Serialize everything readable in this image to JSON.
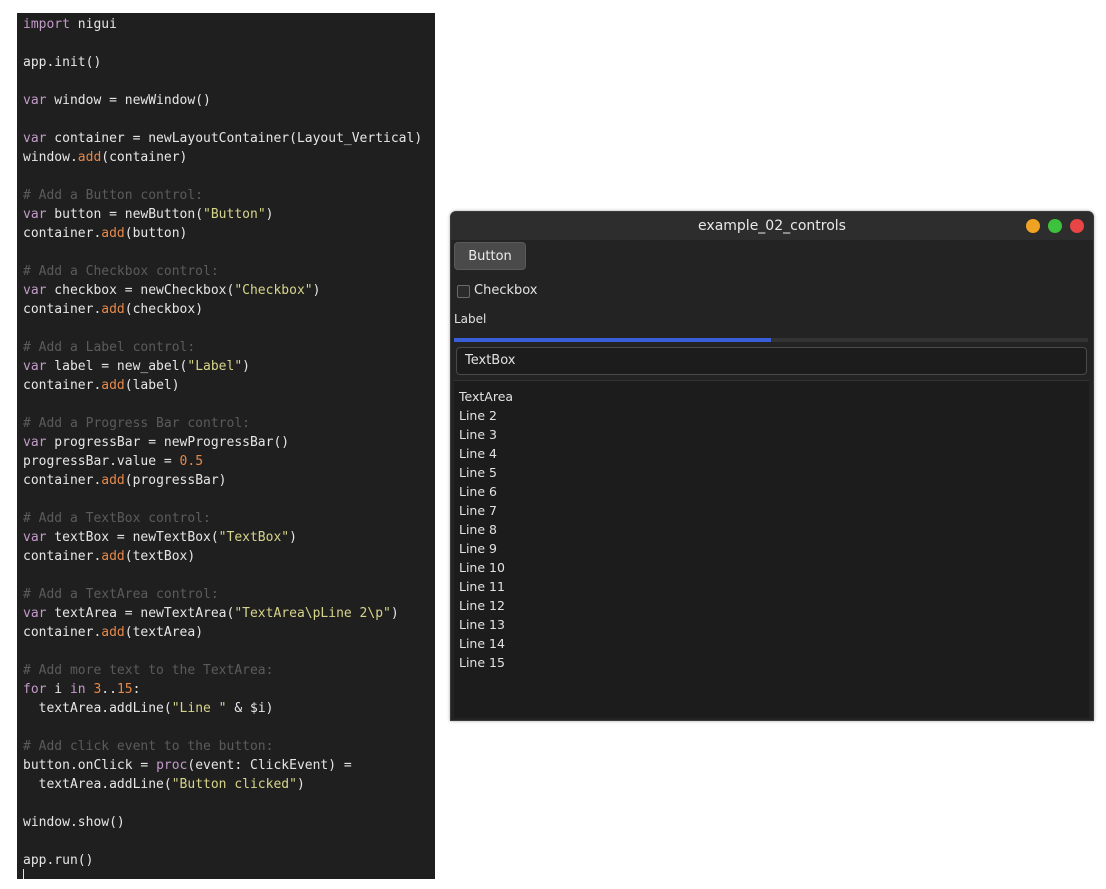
{
  "editor": {
    "lines": [
      [
        {
          "t": "import",
          "c": "kw"
        },
        {
          "t": " nigui",
          "c": "plain"
        }
      ],
      [],
      [
        {
          "t": "app.init()",
          "c": "plain"
        }
      ],
      [],
      [
        {
          "t": "var",
          "c": "kw"
        },
        {
          "t": " window = newWindow()",
          "c": "plain"
        }
      ],
      [],
      [
        {
          "t": "var",
          "c": "kw"
        },
        {
          "t": " container = newLayoutContainer(Layout_Vertical)",
          "c": "plain"
        }
      ],
      [
        {
          "t": "window.",
          "c": "plain"
        },
        {
          "t": "add",
          "c": "fn"
        },
        {
          "t": "(container)",
          "c": "plain"
        }
      ],
      [],
      [
        {
          "t": "# Add a Button control:",
          "c": "com"
        }
      ],
      [
        {
          "t": "var",
          "c": "kw"
        },
        {
          "t": " button = newButton(",
          "c": "plain"
        },
        {
          "t": "\"Button\"",
          "c": "str"
        },
        {
          "t": ")",
          "c": "plain"
        }
      ],
      [
        {
          "t": "container.",
          "c": "plain"
        },
        {
          "t": "add",
          "c": "fn"
        },
        {
          "t": "(button)",
          "c": "plain"
        }
      ],
      [],
      [
        {
          "t": "# Add a Checkbox control:",
          "c": "com"
        }
      ],
      [
        {
          "t": "var",
          "c": "kw"
        },
        {
          "t": " checkbox = newCheckbox(",
          "c": "plain"
        },
        {
          "t": "\"Checkbox\"",
          "c": "str"
        },
        {
          "t": ")",
          "c": "plain"
        }
      ],
      [
        {
          "t": "container.",
          "c": "plain"
        },
        {
          "t": "add",
          "c": "fn"
        },
        {
          "t": "(checkbox)",
          "c": "plain"
        }
      ],
      [],
      [
        {
          "t": "# Add a Label control:",
          "c": "com"
        }
      ],
      [
        {
          "t": "var",
          "c": "kw"
        },
        {
          "t": " label = new_abel(",
          "c": "plain"
        },
        {
          "t": "\"Label\"",
          "c": "str"
        },
        {
          "t": ")",
          "c": "plain"
        }
      ],
      [
        {
          "t": "container.",
          "c": "plain"
        },
        {
          "t": "add",
          "c": "fn"
        },
        {
          "t": "(label)",
          "c": "plain"
        }
      ],
      [],
      [
        {
          "t": "# Add a Progress Bar control:",
          "c": "com"
        }
      ],
      [
        {
          "t": "var",
          "c": "kw"
        },
        {
          "t": " progressBar = newProgressBar()",
          "c": "plain"
        }
      ],
      [
        {
          "t": "progressBar.value = ",
          "c": "plain"
        },
        {
          "t": "0.5",
          "c": "num"
        }
      ],
      [
        {
          "t": "container.",
          "c": "plain"
        },
        {
          "t": "add",
          "c": "fn"
        },
        {
          "t": "(progressBar)",
          "c": "plain"
        }
      ],
      [],
      [
        {
          "t": "# Add a TextBox control:",
          "c": "com"
        }
      ],
      [
        {
          "t": "var",
          "c": "kw"
        },
        {
          "t": " textBox = newTextBox(",
          "c": "plain"
        },
        {
          "t": "\"TextBox\"",
          "c": "str"
        },
        {
          "t": ")",
          "c": "plain"
        }
      ],
      [
        {
          "t": "container.",
          "c": "plain"
        },
        {
          "t": "add",
          "c": "fn"
        },
        {
          "t": "(textBox)",
          "c": "plain"
        }
      ],
      [],
      [
        {
          "t": "# Add a TextArea control:",
          "c": "com"
        }
      ],
      [
        {
          "t": "var",
          "c": "kw"
        },
        {
          "t": " textArea = newTextArea(",
          "c": "plain"
        },
        {
          "t": "\"TextArea\\pLine 2\\p\"",
          "c": "str"
        },
        {
          "t": ")",
          "c": "plain"
        }
      ],
      [
        {
          "t": "container.",
          "c": "plain"
        },
        {
          "t": "add",
          "c": "fn"
        },
        {
          "t": "(textArea)",
          "c": "plain"
        }
      ],
      [],
      [
        {
          "t": "# Add more text to the TextArea:",
          "c": "com"
        }
      ],
      [
        {
          "t": "for",
          "c": "kw"
        },
        {
          "t": " i ",
          "c": "plain"
        },
        {
          "t": "in",
          "c": "kw"
        },
        {
          "t": " ",
          "c": "plain"
        },
        {
          "t": "3",
          "c": "num"
        },
        {
          "t": "..",
          "c": "plain"
        },
        {
          "t": "15",
          "c": "num"
        },
        {
          "t": ":",
          "c": "plain"
        }
      ],
      [
        {
          "t": "  textArea.addLine(",
          "c": "plain"
        },
        {
          "t": "\"Line \"",
          "c": "str"
        },
        {
          "t": " & $i)",
          "c": "plain"
        }
      ],
      [],
      [
        {
          "t": "# Add click event to the button:",
          "c": "com"
        }
      ],
      [
        {
          "t": "button.onClick = ",
          "c": "plain"
        },
        {
          "t": "proc",
          "c": "kw"
        },
        {
          "t": "(event: ClickEvent) =",
          "c": "plain"
        }
      ],
      [
        {
          "t": "  textArea.addLine(",
          "c": "plain"
        },
        {
          "t": "\"Button clicked\"",
          "c": "str"
        },
        {
          "t": ")",
          "c": "plain"
        }
      ],
      [],
      [
        {
          "t": "window.show()",
          "c": "plain"
        }
      ],
      [],
      [
        {
          "t": "app.run()",
          "c": "plain"
        }
      ]
    ],
    "colors": {
      "kw": "#c39ac9",
      "fn": "#e5884a",
      "str": "#d6d48a",
      "num": "#e5884a",
      "com": "#5b5b5b",
      "plain": "#e6e6e6"
    }
  },
  "window": {
    "title": "example_02_controls",
    "button_label": "Button",
    "checkbox_label": "Checkbox",
    "checkbox_checked": false,
    "label_text": "Label",
    "progress_value": 0.5,
    "textbox_value": "TextBox",
    "textarea_lines": [
      "TextArea",
      "Line 2",
      "Line 3",
      "Line 4",
      "Line 5",
      "Line 6",
      "Line 7",
      "Line 8",
      "Line 9",
      "Line 10",
      "Line 11",
      "Line 12",
      "Line 13",
      "Line 14",
      "Line 15"
    ],
    "controls_colors": {
      "minimize": "#f0a323",
      "maximize": "#3cc23c",
      "close": "#e84646",
      "progress": "#3a5ed8"
    }
  }
}
